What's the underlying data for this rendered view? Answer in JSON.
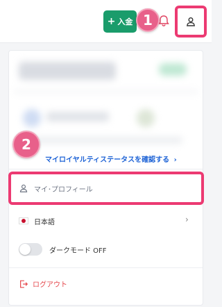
{
  "header": {
    "deposit_label": "入金",
    "deposit_plus": "+"
  },
  "annotations": {
    "step1": "1",
    "step2": "2"
  },
  "menu": {
    "loyalty_link": "マイロイヤルティステータスを確認する",
    "loyalty_chevron": "›",
    "profile_label": "マイ･プロフィール",
    "language_label": "日本語",
    "language_chevron": "›",
    "dark_mode_label": "ダークモード OFF",
    "logout_label": "ログアウト"
  },
  "colors": {
    "accent_green": "#1a9c6b",
    "highlight_pink": "#ec3a72",
    "badge_pink": "#e8608a",
    "link_blue": "#1e63d6",
    "logout_red": "#e5484d"
  },
  "icons": [
    "plus-icon",
    "bell-icon",
    "user-icon",
    "japan-flag-icon",
    "chevron-right-icon",
    "logout-icon"
  ]
}
